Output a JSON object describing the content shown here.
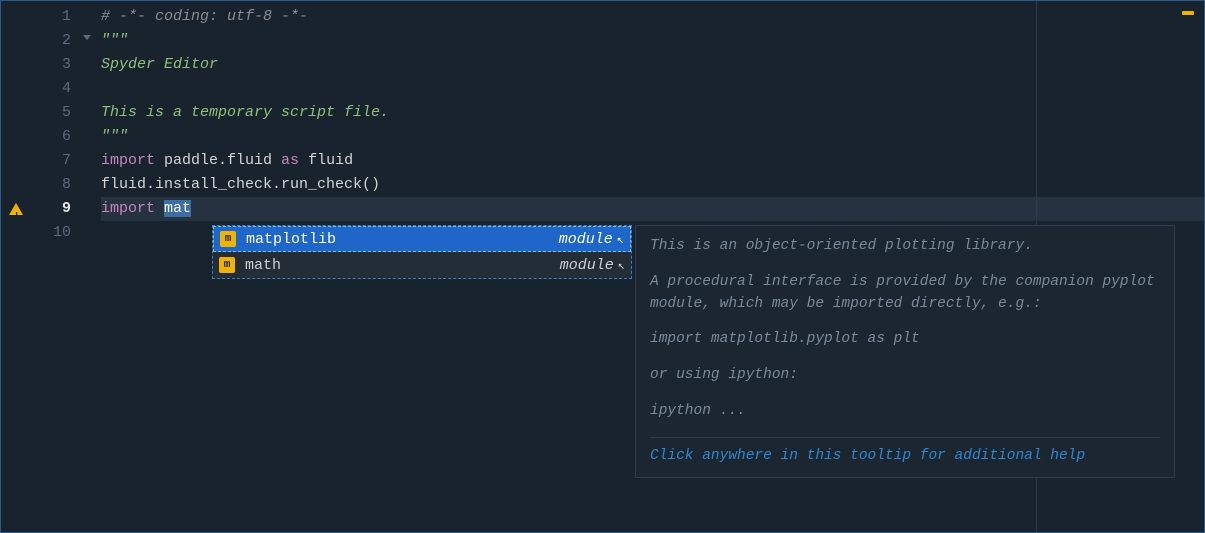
{
  "gutter": {
    "lines": [
      "1",
      "2",
      "3",
      "4",
      "5",
      "6",
      "7",
      "8",
      "9",
      "10"
    ],
    "current_index": 8,
    "fold_at": 1,
    "warning_at": 8
  },
  "code": {
    "l1_comment": "# -*- coding: utf-8 -*-",
    "l2_doc": "\"\"\"",
    "l3_doc": "Spyder Editor",
    "l4_doc": "",
    "l5_doc": "This is a temporary script file.",
    "l6_doc": "\"\"\"",
    "l7_kw1": "import",
    "l7_rest": " paddle.fluid ",
    "l7_kw2": "as",
    "l7_rest2": " fluid",
    "l8": "fluid.install_check.run_check()",
    "l9_kw": "import",
    "l9_space": " ",
    "l9_typed": "mat"
  },
  "autocomplete": {
    "items": [
      {
        "icon": "m",
        "name": "matplotlib",
        "kind": "module",
        "selected": true
      },
      {
        "icon": "m",
        "name": "math",
        "kind": "module",
        "selected": false
      }
    ]
  },
  "doc": {
    "p1": "This is an object-oriented plotting library.",
    "p2": "A procedural interface is provided by the companion pyplot module, which may be imported directly, e.g.:",
    "p3": "import matplotlib.pyplot as plt",
    "p4": "or using ipython:",
    "p5": "ipython ...",
    "hint": "Click anywhere in this tooltip for additional help"
  }
}
